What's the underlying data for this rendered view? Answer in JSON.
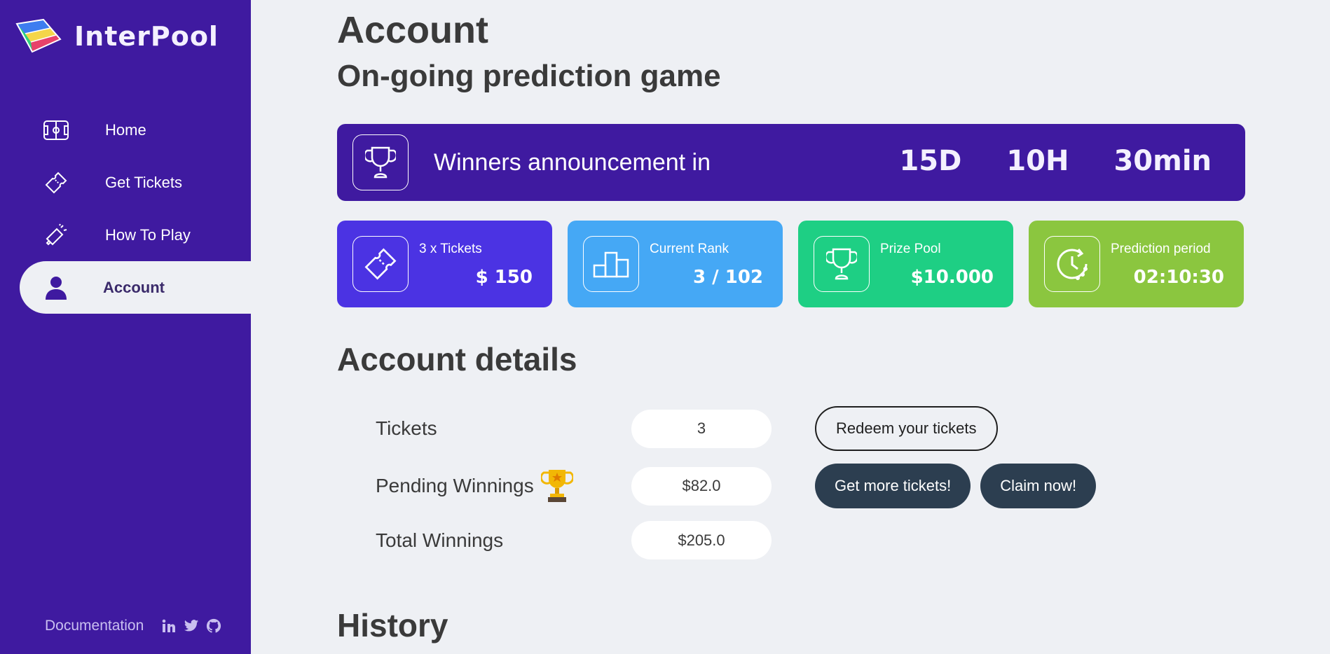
{
  "app": {
    "name": "InterPool"
  },
  "sidebar": {
    "items": [
      {
        "label": "Home",
        "icon": "field-icon"
      },
      {
        "label": "Get Tickets",
        "icon": "ticket-icon"
      },
      {
        "label": "How To Play",
        "icon": "megaphone-icon"
      },
      {
        "label": "Account",
        "icon": "user-icon",
        "active": true
      }
    ],
    "footer": {
      "documentation": "Documentation",
      "social": [
        "linkedin-icon",
        "twitter-icon",
        "github-icon"
      ]
    }
  },
  "page": {
    "title": "Account",
    "subtitle": "On-going prediction game"
  },
  "banner": {
    "text": "Winners announcement in",
    "days": "15D",
    "hours": "10H",
    "minutes": "30min"
  },
  "stats": [
    {
      "label": "3 x Tickets",
      "value": "$ 150",
      "color": "#4b33e3",
      "icon": "ticket-icon"
    },
    {
      "label": "Current Rank",
      "value": "3 / 102",
      "color": "#45a8f5",
      "icon": "podium-icon"
    },
    {
      "label": "Prize Pool",
      "value": "$10.000",
      "color": "#1ecf84",
      "icon": "trophy-icon"
    },
    {
      "label": "Prediction period",
      "value": "02:10:30",
      "color": "#8bc63f",
      "icon": "clock-icon"
    }
  ],
  "account_details": {
    "title": "Account details",
    "tickets_label": "Tickets",
    "tickets_value": "3",
    "redeem_button": "Redeem your tickets",
    "pending_label": "Pending Winnings",
    "pending_value": "$82.0",
    "get_more_button": "Get more tickets!",
    "claim_button": "Claim now!",
    "total_label": "Total Winnings",
    "total_value": "$205.0"
  },
  "history": {
    "title": "History"
  },
  "colors": {
    "sidebar": "#3f1aa0",
    "background": "#eef0f4",
    "dark_button": "#2c3e50"
  }
}
